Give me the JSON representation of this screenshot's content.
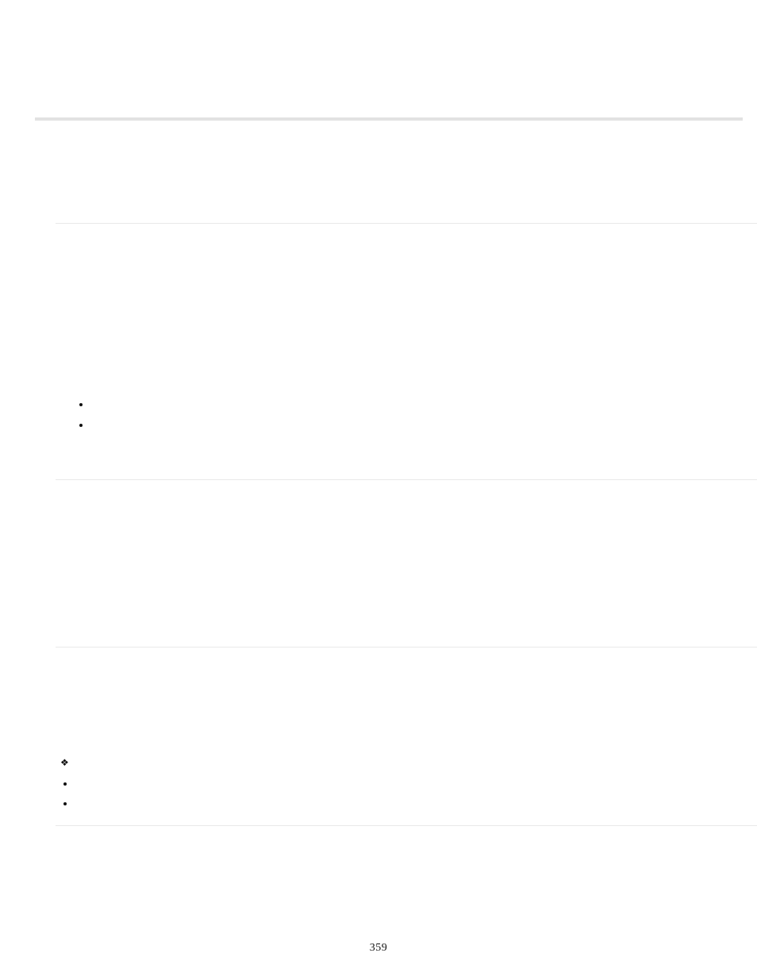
{
  "page_number": "359",
  "top_rule_color": "#e2e2e2",
  "divider_color": "#e9e9e9",
  "bullets_section1": [
    "",
    ""
  ],
  "ornament_section3": "",
  "bullets_section3": [
    "",
    ""
  ]
}
